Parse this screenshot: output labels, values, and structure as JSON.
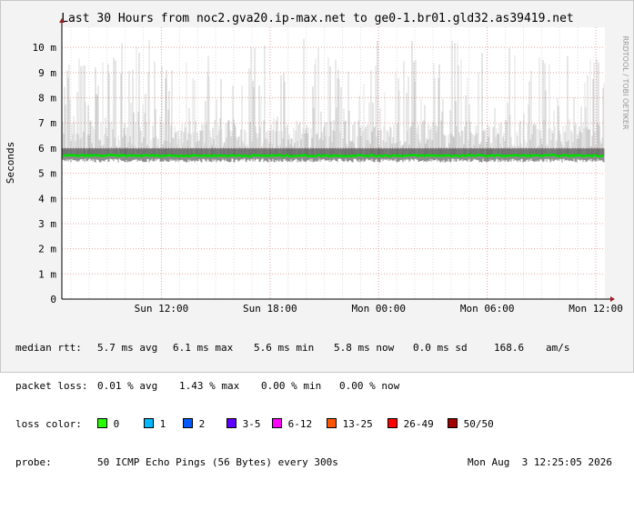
{
  "chart_data": {
    "type": "line",
    "title": "Last 30 Hours from noc2.gva20.ip-max.net to ge0-1.br01.gld32.as39419.net",
    "ylabel": "Seconds",
    "side_label": "RRDTOOL / TOBI OETIKER",
    "ylim": [
      0,
      0.0108
    ],
    "y_ticks": [
      {
        "value": 0,
        "label": "0"
      },
      {
        "value": 0.001,
        "label": "1 m"
      },
      {
        "value": 0.002,
        "label": "2 m"
      },
      {
        "value": 0.003,
        "label": "3 m"
      },
      {
        "value": 0.004,
        "label": "4 m"
      },
      {
        "value": 0.005,
        "label": "5 m"
      },
      {
        "value": 0.006,
        "label": "6 m"
      },
      {
        "value": 0.007,
        "label": "7 m"
      },
      {
        "value": 0.008,
        "label": "8 m"
      },
      {
        "value": 0.009,
        "label": "9 m"
      },
      {
        "value": 0.01,
        "label": "10 m"
      }
    ],
    "x_range_hours": [
      0,
      30
    ],
    "x_ticks": [
      {
        "hours": 5.5,
        "label": "Sun 12:00"
      },
      {
        "hours": 11.5,
        "label": "Sun 18:00"
      },
      {
        "hours": 17.5,
        "label": "Mon 00:00"
      },
      {
        "hours": 23.5,
        "label": "Mon 06:00"
      },
      {
        "hours": 29.5,
        "label": "Mon 12:00"
      }
    ],
    "series": [
      {
        "name": "median rtt",
        "color": "#00dd00",
        "mean": 0.0057,
        "max": 0.0061,
        "min": 0.0056,
        "now": 0.0058
      }
    ],
    "spread_max": 0.0105,
    "colors": {
      "background": "#ffffff",
      "grid": "#e9a8a8",
      "minor_grid": "#dddddd",
      "median": "#00dd00",
      "smoke": "#000000",
      "axis": "#000000",
      "arrow": "#a02020"
    }
  },
  "stats": {
    "median_label": "median rtt:",
    "median_avg": "5.7 ms avg",
    "median_max": "6.1 ms max",
    "median_min": "5.6 ms min",
    "median_now": "5.8 ms now",
    "median_sd": "0.0 ms sd",
    "median_amss": "168.6",
    "median_unit": "am/s",
    "loss_label": "packet loss:",
    "loss_avg": "0.01 % avg",
    "loss_max": "1.43 % max",
    "loss_min": "0.00 % min",
    "loss_now": "0.00 % now",
    "color_label": "loss color:",
    "loss_colors": [
      {
        "label": "0",
        "color": "#26ff00"
      },
      {
        "label": "1",
        "color": "#00b8ff"
      },
      {
        "label": "2",
        "color": "#0059ff"
      },
      {
        "label": "3-5",
        "color": "#5e00ff"
      },
      {
        "label": "6-12",
        "color": "#ff00ff"
      },
      {
        "label": "13-25",
        "color": "#ff5500"
      },
      {
        "label": "26-49",
        "color": "#ff0000"
      },
      {
        "label": "50/50",
        "color": "#a10000"
      }
    ],
    "probe_label": "probe:",
    "probe_text": "50 ICMP Echo Pings (56 Bytes) every 300s",
    "timestamp": "Mon Aug  3 12:25:05 2026"
  }
}
